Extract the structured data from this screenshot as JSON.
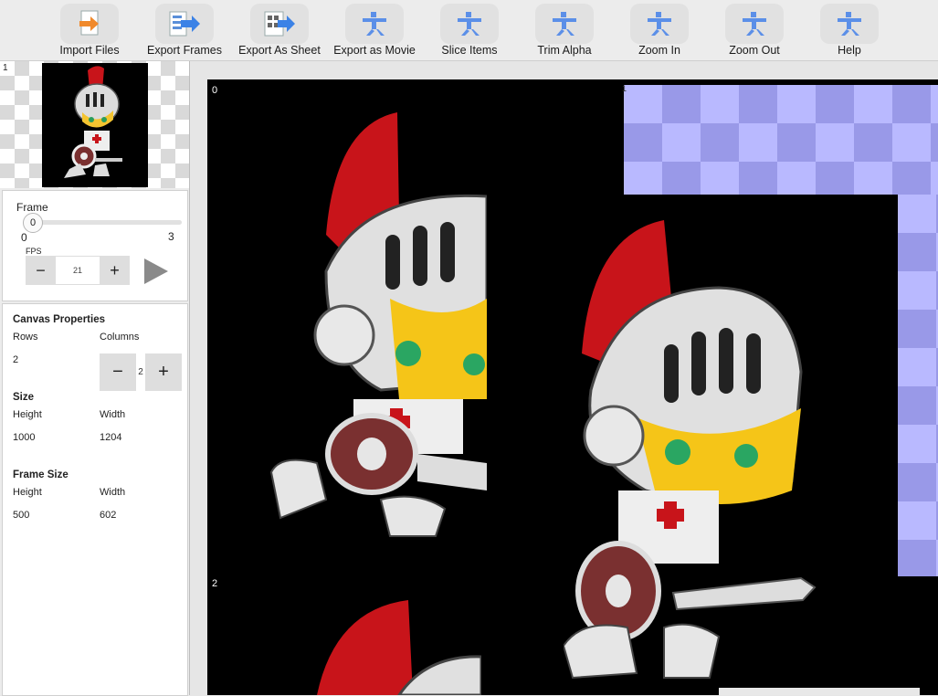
{
  "toolbar": {
    "buttons": [
      {
        "label": "Import Files",
        "icon": "import-icon"
      },
      {
        "label": "Export Frames",
        "icon": "export-frames-icon"
      },
      {
        "label": "Export As Sheet",
        "icon": "export-sheet-icon"
      },
      {
        "label": "Export as Movie",
        "icon": "movie-icon"
      },
      {
        "label": "Slice Items",
        "icon": "slice-icon"
      },
      {
        "label": "Trim Alpha",
        "icon": "trim-icon"
      },
      {
        "label": "Zoom In",
        "icon": "zoom-in-icon"
      },
      {
        "label": "Zoom Out",
        "icon": "zoom-out-icon"
      },
      {
        "label": "Help",
        "icon": "help-icon"
      }
    ]
  },
  "thumbnails": {
    "first_index": "1"
  },
  "frame_panel": {
    "title": "Frame",
    "slider_value": "0",
    "slider_min": "0",
    "slider_max": "3",
    "fps_label": "FPS",
    "fps_value": "21",
    "minus": "−",
    "plus": "+"
  },
  "canvas": {
    "title": "Canvas Properties",
    "rows_label": "Rows",
    "columns_label": "Columns",
    "rows_value": "2",
    "columns_value": "2",
    "size_title": "Size",
    "size_height_label": "Height",
    "size_width_label": "Width",
    "size_height": "1000",
    "size_width": "1204",
    "frame_title": "Frame Size",
    "frame_height_label": "Height",
    "frame_width_label": "Width",
    "frame_height": "500",
    "frame_width": "602"
  },
  "stage": {
    "cell_labels": [
      "0",
      "1",
      "2"
    ]
  },
  "colors": {
    "accent": "#3b82e6",
    "background": "#ececec",
    "stage": "#000000",
    "highlight": "#b9b9ff"
  }
}
